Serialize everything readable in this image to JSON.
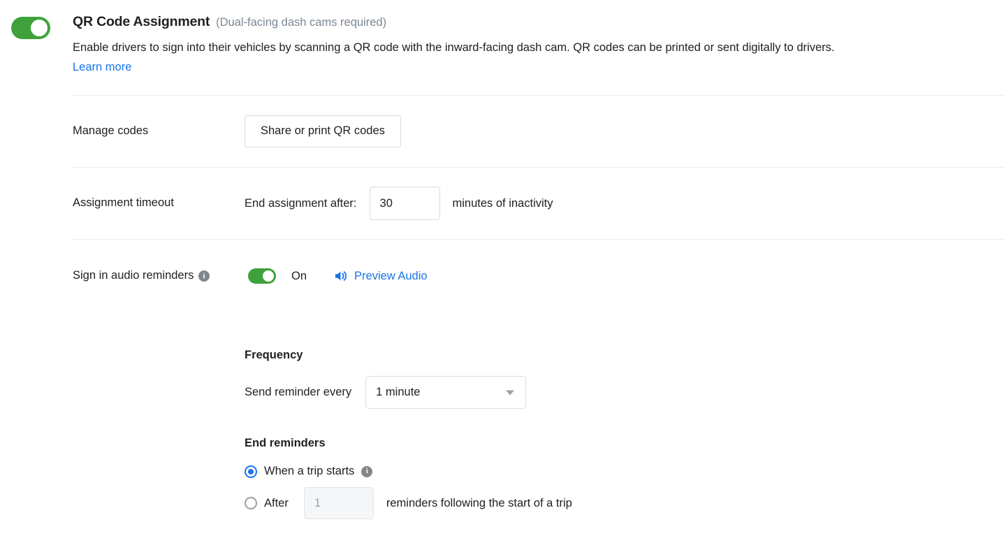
{
  "feature": {
    "toggle_state": "on",
    "title": "QR Code Assignment",
    "subtitle": "(Dual-facing dash cams required)",
    "description": "Enable drivers to sign into their vehicles by scanning a QR code with the inward-facing dash cam. QR codes can be printed or sent digitally to drivers.",
    "learn_more_label": "Learn more"
  },
  "rows": {
    "manage_codes": {
      "label": "Manage codes",
      "button_label": "Share or print QR codes"
    },
    "assignment_timeout": {
      "label": "Assignment timeout",
      "prefix_text": "End assignment after:",
      "value": "30",
      "suffix_text": "minutes of inactivity"
    },
    "audio_reminders": {
      "label": "Sign in audio reminders",
      "info_glyph": "i",
      "toggle_state": "on",
      "state_label": "On",
      "preview_label": "Preview Audio"
    }
  },
  "frequency": {
    "heading": "Frequency",
    "label": "Send reminder every",
    "selected_option": "1 minute"
  },
  "end_reminders": {
    "heading": "End reminders",
    "options": [
      {
        "label": "When a trip starts",
        "checked": true,
        "info_glyph": "i"
      },
      {
        "label_prefix": "After",
        "input_value": "1",
        "label_suffix": "reminders following the start of a trip",
        "checked": false,
        "disabled": true
      }
    ]
  },
  "colors": {
    "toggle_on": "#3fa13c",
    "link_blue": "#1a73e8",
    "radio_blue": "#1a73e8",
    "info_gray": "#80868b",
    "divider": "#ececee"
  }
}
